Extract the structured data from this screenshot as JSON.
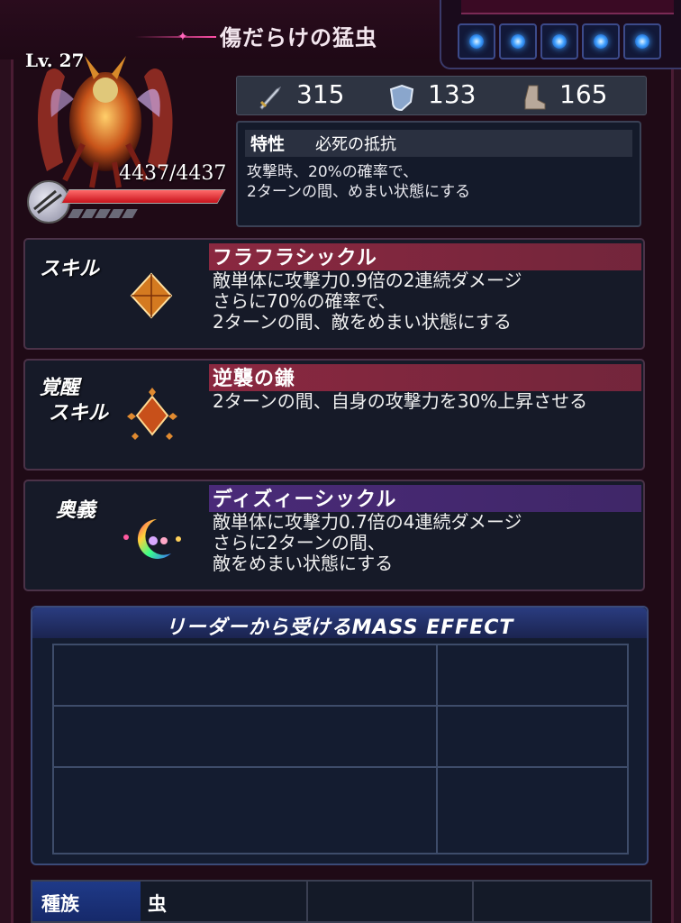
{
  "unit": {
    "name": "傷だらけの猛虫",
    "level": "Lv. 27",
    "hp": "4437/4437",
    "hp_fraction": 1.0
  },
  "header": {
    "gem_count": 5,
    "gem_color": "#3fa0ff"
  },
  "stats": {
    "attack": "315",
    "defense": "133",
    "speed": "165",
    "attack_icon": "sword-icon",
    "defense_icon": "shield-icon",
    "speed_icon": "boot-icon"
  },
  "trait": {
    "label": "特性",
    "name": "必死の抵抗",
    "description": "攻撃時、20%の確率で、\n2ターンの間、めまい状態にする"
  },
  "skill": {
    "label": "スキル",
    "name": "フラフラシックル",
    "description": "敵単体に攻撃力0.9倍の2連続ダメージ\nさらに70%の確率で、\n2ターンの間、敵をめまい状態にする",
    "bar_color": "#8a2840",
    "icon": "amber-crystal-icon"
  },
  "awakened_skill": {
    "label_line1": "覚醒",
    "label_line2": "スキル",
    "name": "逆襲の鎌",
    "description": "2ターンの間、自身の攻撃力を30%上昇させる",
    "bar_color": "#8a2840",
    "icon": "crystal-cluster-icon"
  },
  "ultimate": {
    "label": "奥義",
    "name": "ディズィーシックル",
    "description": "敵単体に攻撃力0.7倍の4連続ダメージ\nさらに2ターンの間、\n敵をめまい状態にする",
    "bar_color": "#4a2a78",
    "icon": "rainbow-crescent-icon"
  },
  "mass_effect": {
    "title": "リーダーから受けるMASS EFFECT"
  },
  "tribe": {
    "label": "種族",
    "value": "虫"
  }
}
